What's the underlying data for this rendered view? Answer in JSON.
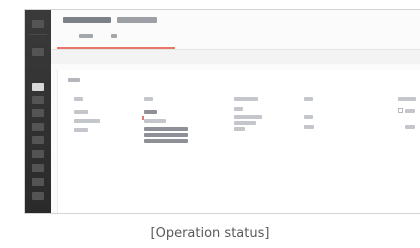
{
  "caption": "[Operation status]"
}
